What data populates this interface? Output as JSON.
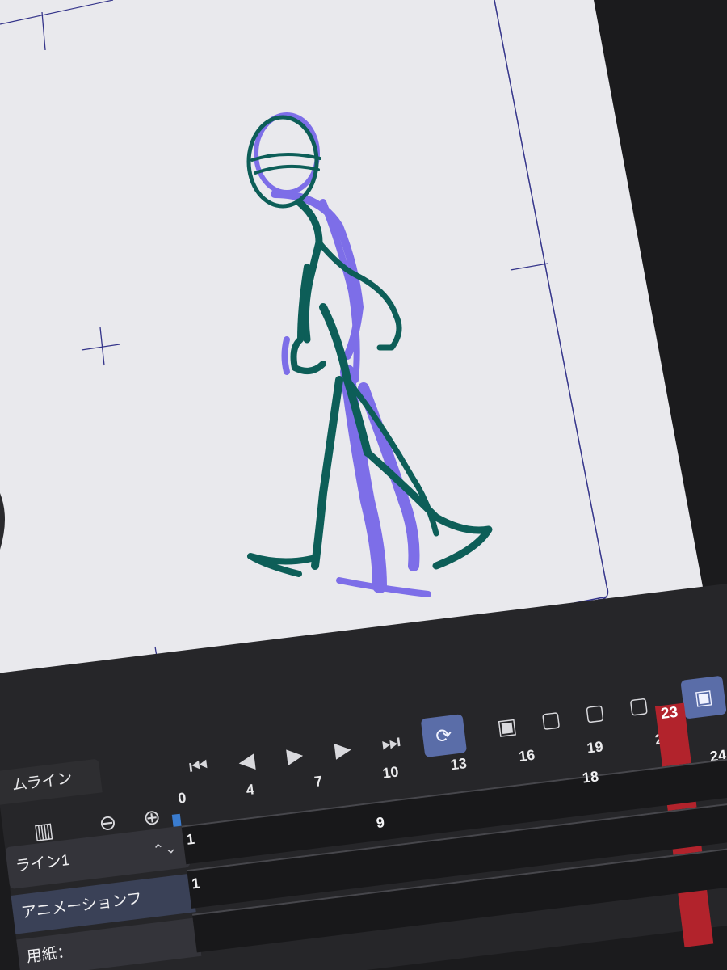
{
  "timeline": {
    "title": "ムライン",
    "ruler_labels": [
      "0",
      "4",
      "7",
      "10",
      "13",
      "16",
      "19",
      "22"
    ],
    "current_frame": "23",
    "overflow_frame": "24",
    "row1_frame_start": "1",
    "row1_frame_label": "9",
    "row1_frame_far": "18",
    "row2_frame_start": "1",
    "tracks": [
      {
        "name": "ライン1"
      },
      {
        "name": "アニメーションフ"
      },
      {
        "name": "用紙："
      }
    ]
  },
  "colors": {
    "accent": "#5a6da8",
    "playhead": "#b2232c",
    "sketch_green": "#0d5e58",
    "sketch_purple": "#7d6ee8",
    "canvas": "#ebebee"
  },
  "icons": [
    "go-to-first-frame-icon",
    "previous-frame-icon",
    "play-icon",
    "next-frame-icon",
    "go-to-last-frame-icon",
    "loop-icon",
    "new-animation-cel-icon",
    "new-cel-icon",
    "link-cel-icon",
    "unlink-cel-icon",
    "onion-skin-icon",
    "zoom-out-icon",
    "zoom-in-icon",
    "add-folder-icon"
  ]
}
